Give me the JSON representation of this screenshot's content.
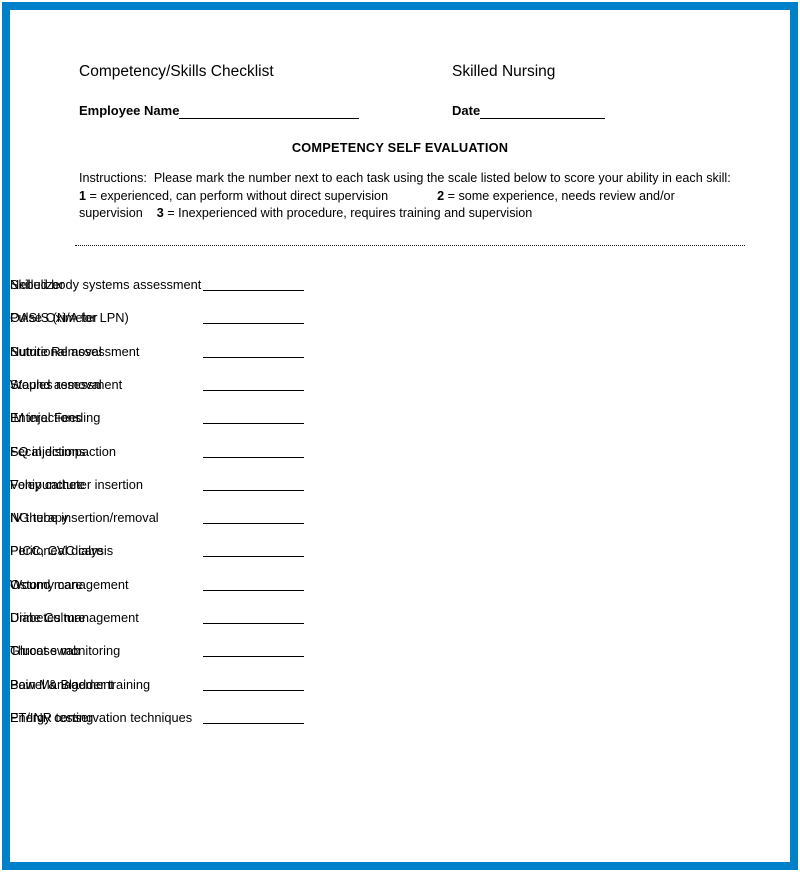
{
  "document": {
    "title": "Competency/Skills Checklist",
    "subtitle": "Skilled Nursing",
    "section_heading": "COMPETENCY SELF EVALUATION"
  },
  "fields": {
    "employee_name_label": "Employee Name",
    "employee_name_value": "",
    "date_label": "Date",
    "date_value": ""
  },
  "instructions": {
    "line1": "Instructions:  Please mark the number next to each task using the scale listed below to score your ability in each skill:",
    "scale_1_number": "1",
    "scale_1_text": " = experienced, can perform without direct supervision",
    "scale_2_number": "2",
    "scale_2_text": " = some experience, needs review and/or supervision",
    "scale_3_number": "3",
    "scale_3_text": " = Inexperienced with procedure, requires training and supervision"
  },
  "colors": {
    "frame_blue": "#0080C8",
    "text_black": "#000000"
  },
  "skills": {
    "left_column": [
      {
        "label": "Skilled body systems assessment",
        "score": ""
      },
      {
        "label": "OASIS (N/A for LPN)",
        "score": ""
      },
      {
        "label": "Nutritional assessment",
        "score": ""
      },
      {
        "label": "Wound assessment",
        "score": ""
      },
      {
        "label": "Enteral Feeding",
        "score": ""
      },
      {
        "label": "Fecal disimpaction",
        "score": ""
      },
      {
        "label": "Foley catheter insertion",
        "score": ""
      },
      {
        "label": "NG tube insertion/removal",
        "score": ""
      },
      {
        "label": "Peritoneal dialysis",
        "score": ""
      },
      {
        "label": "Wound management",
        "score": ""
      },
      {
        "label": "Diabetes management",
        "score": ""
      },
      {
        "label": "Glucose monitoring",
        "score": ""
      },
      {
        "label": "Pain Management",
        "score": ""
      },
      {
        "label": "Energy conservation techniques",
        "score": ""
      }
    ],
    "right_column": [
      {
        "label": "Nebulizer",
        "score": ""
      },
      {
        "label": "Pulse Oximeter",
        "score": ""
      },
      {
        "label": "Suture Removal",
        "score": ""
      },
      {
        "label": "Staples removal",
        "score": ""
      },
      {
        "label": "IM injections",
        "score": ""
      },
      {
        "label": "SQ injections",
        "score": ""
      },
      {
        "label": "Venipuncture",
        "score": ""
      },
      {
        "label": "IV therapy",
        "score": ""
      },
      {
        "label": "PICC, CVC care",
        "score": ""
      },
      {
        "label": "Ostomy care",
        "score": ""
      },
      {
        "label": "Urine Culture",
        "score": ""
      },
      {
        "label": "Throat swab",
        "score": ""
      },
      {
        "label": "Bowel &amp; Bladder training",
        "score": ""
      },
      {
        "label": "PT/INR testing",
        "score": ""
      }
    ]
  }
}
